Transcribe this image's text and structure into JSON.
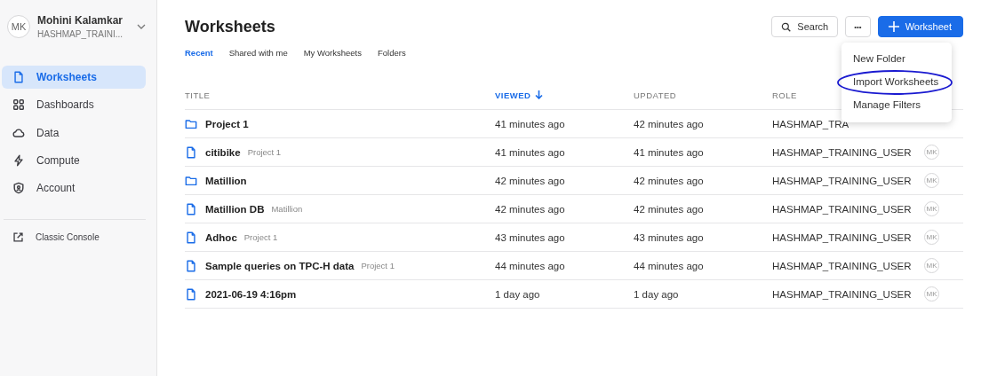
{
  "user": {
    "initials": "MK",
    "name": "Mohini Kalamkar",
    "account": "HASHMAP_TRAINI..."
  },
  "nav": [
    {
      "label": "Worksheets",
      "selected": true
    },
    {
      "label": "Dashboards",
      "selected": false
    },
    {
      "label": "Data",
      "selected": false
    },
    {
      "label": "Compute",
      "selected": false
    },
    {
      "label": "Account",
      "selected": false
    }
  ],
  "classic_console": "Classic Console",
  "title": "Worksheets",
  "search_button": "Search",
  "more_button": "•••",
  "new_button": "Worksheet",
  "tabs": [
    {
      "label": "Recent",
      "selected": true
    },
    {
      "label": "Shared with me",
      "selected": false
    },
    {
      "label": "My Worksheets",
      "selected": false
    },
    {
      "label": "Folders",
      "selected": false
    }
  ],
  "menu": [
    {
      "label": "New Folder",
      "highlighted": false
    },
    {
      "label": "Import Worksheets",
      "highlighted": true
    },
    {
      "label": "Manage Filters",
      "highlighted": false
    }
  ],
  "columns": [
    {
      "label": "TITLE",
      "sorted": false
    },
    {
      "label": "VIEWED",
      "sorted": true
    },
    {
      "label": "UPDATED",
      "sorted": false
    },
    {
      "label": "ROLE",
      "sorted": false
    }
  ],
  "rows": [
    {
      "kind": "folder",
      "title": "Project 1",
      "viewed": "41 minutes ago",
      "updated": "42 minutes ago",
      "role": "HASHMAP_TRA"
    },
    {
      "kind": "worksheet",
      "title": "citibike",
      "folder": "Project 1",
      "viewed": "41 minutes ago",
      "updated": "41 minutes ago",
      "role": "HASHMAP_TRAINING_USER",
      "owner": "MK"
    },
    {
      "kind": "folder",
      "title": "Matillion",
      "viewed": "42 minutes ago",
      "updated": "42 minutes ago",
      "role": "HASHMAP_TRAINING_USER",
      "owner": "MK"
    },
    {
      "kind": "worksheet",
      "title": "Matillion DB",
      "folder": "Matillion",
      "viewed": "42 minutes ago",
      "updated": "42 minutes ago",
      "role": "HASHMAP_TRAINING_USER",
      "owner": "MK"
    },
    {
      "kind": "worksheet",
      "title": "Adhoc",
      "folder": "Project 1",
      "viewed": "43 minutes ago",
      "updated": "43 minutes ago",
      "role": "HASHMAP_TRAINING_USER",
      "owner": "MK"
    },
    {
      "kind": "worksheet",
      "title": "Sample queries on TPC-H data",
      "folder": "Project 1",
      "viewed": "44 minutes ago",
      "updated": "44 minutes ago",
      "role": "HASHMAP_TRAINING_USER",
      "owner": "MK"
    },
    {
      "kind": "worksheet",
      "title": "2021-06-19 4:16pm",
      "viewed": "1 day ago",
      "updated": "1 day ago",
      "role": "HASHMAP_TRAINING_USER",
      "owner": "MK"
    }
  ]
}
